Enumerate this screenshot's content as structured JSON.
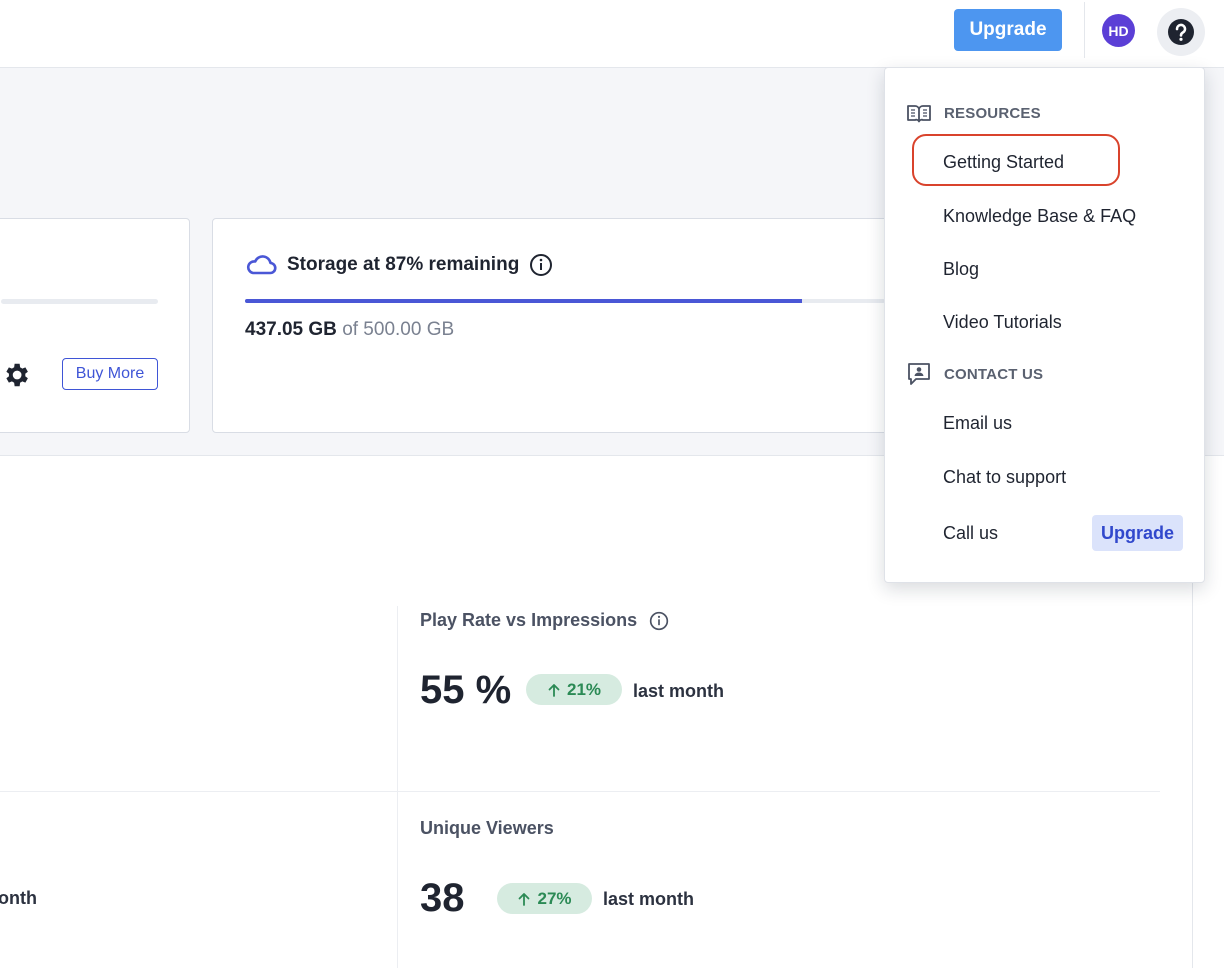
{
  "header": {
    "upgrade_label": "Upgrade",
    "avatar_initials": "HD",
    "help_icon": "question-circle-icon"
  },
  "plan_card": {
    "buy_more_label": "Buy More",
    "settings_icon": "gear-icon"
  },
  "storage": {
    "icon": "cloud-icon",
    "title": "Storage at 87% remaining",
    "info_icon": "info-icon",
    "used": "437.05 GB",
    "of_total": "of 500.00 GB",
    "fill_percent": 87,
    "accent": "#4a57d6"
  },
  "metrics": {
    "left_top_period_fragment": "onth",
    "play_rate": {
      "label": "Play Rate vs Impressions",
      "value": "55 %",
      "change": "21%",
      "period": "last month"
    },
    "unique_viewers": {
      "label": "Unique Viewers",
      "value": "38",
      "change": "27%",
      "period": "last month"
    }
  },
  "help_menu": {
    "resources": {
      "heading": "RESOURCES",
      "icon": "book-open-icon",
      "items": [
        "Getting Started",
        "Knowledge Base & FAQ",
        "Blog",
        "Video Tutorials"
      ]
    },
    "contact": {
      "heading": "CONTACT US",
      "icon": "chat-person-icon",
      "items": [
        "Email us",
        "Chat to support",
        "Call us"
      ],
      "upgrade_label": "Upgrade"
    }
  }
}
